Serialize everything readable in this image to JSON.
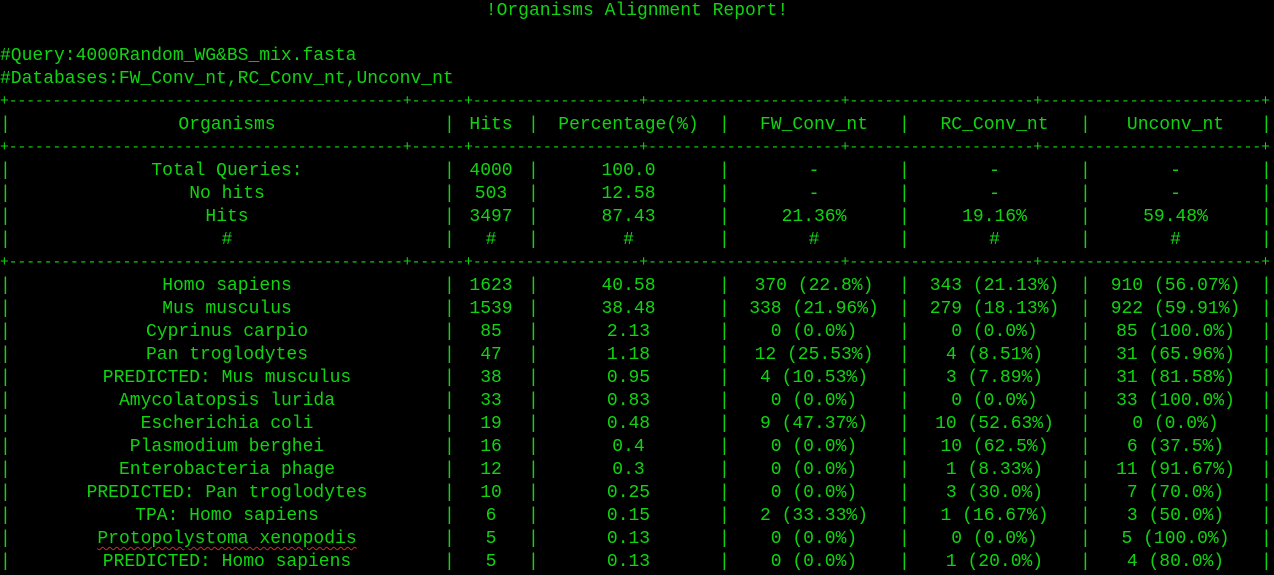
{
  "title": "!Organisms Alignment Report!",
  "query_line": "#Query:4000Random_WG&BS_mix.fasta",
  "databases_line": "#Databases:FW_Conv_nt,RC_Conv_nt,Unconv_nt",
  "separator": "+---------------------------------------------+------+-------------------+----------------------+---------------------+-------------------------+",
  "table": {
    "headers": [
      "Organisms",
      "Hits",
      "Percentage(%)",
      "FW_Conv_nt",
      "RC_Conv_nt",
      "Unconv_nt"
    ],
    "summary_rows": [
      [
        "Total Queries:",
        "4000",
        "100.0",
        "-",
        "-",
        "-"
      ],
      [
        "No hits",
        "503",
        "12.58",
        "-",
        "-",
        "-"
      ],
      [
        "Hits",
        "3497",
        "87.43",
        "21.36%",
        "19.16%",
        "59.48%"
      ],
      [
        "#",
        "#",
        "#",
        "#",
        "#",
        "#"
      ]
    ],
    "organism_rows": [
      [
        "Homo sapiens",
        "1623",
        "40.58",
        "370 (22.8%)",
        "343 (21.13%)",
        "910 (56.07%)"
      ],
      [
        "Mus musculus",
        "1539",
        "38.48",
        "338 (21.96%)",
        "279 (18.13%)",
        "922 (59.91%)"
      ],
      [
        "Cyprinus carpio",
        "85",
        "2.13",
        "0 (0.0%)",
        "0 (0.0%)",
        "85 (100.0%)"
      ],
      [
        "Pan troglodytes",
        "47",
        "1.18",
        "12 (25.53%)",
        "4 (8.51%)",
        "31 (65.96%)"
      ],
      [
        "PREDICTED: Mus musculus",
        "38",
        "0.95",
        "4 (10.53%)",
        "3 (7.89%)",
        "31 (81.58%)"
      ],
      [
        "Amycolatopsis lurida",
        "33",
        "0.83",
        "0 (0.0%)",
        "0 (0.0%)",
        "33 (100.0%)"
      ],
      [
        "Escherichia coli",
        "19",
        "0.48",
        "9 (47.37%)",
        "10 (52.63%)",
        "0 (0.0%)"
      ],
      [
        "Plasmodium berghei",
        "16",
        "0.4",
        "0 (0.0%)",
        "10 (62.5%)",
        "6 (37.5%)"
      ],
      [
        "Enterobacteria phage",
        "12",
        "0.3",
        "0 (0.0%)",
        "1 (8.33%)",
        "11 (91.67%)"
      ],
      [
        "PREDICTED: Pan troglodytes",
        "10",
        "0.25",
        "0 (0.0%)",
        "3 (30.0%)",
        "7 (70.0%)"
      ],
      [
        "TPA: Homo sapiens",
        "6",
        "0.15",
        "2 (33.33%)",
        "1 (16.67%)",
        "3 (50.0%)"
      ],
      [
        "Protopolystoma xenopodis",
        "5",
        "0.13",
        "0 (0.0%)",
        "0 (0.0%)",
        "5 (100.0%)"
      ],
      [
        "PREDICTED: Homo sapiens",
        "5",
        "0.13",
        "0 (0.0%)",
        "1 (20.0%)",
        "4 (80.0%)"
      ]
    ]
  },
  "colors": {
    "background": "#000000",
    "text": "#11d411",
    "spellcheck_underline": "#c03030"
  }
}
